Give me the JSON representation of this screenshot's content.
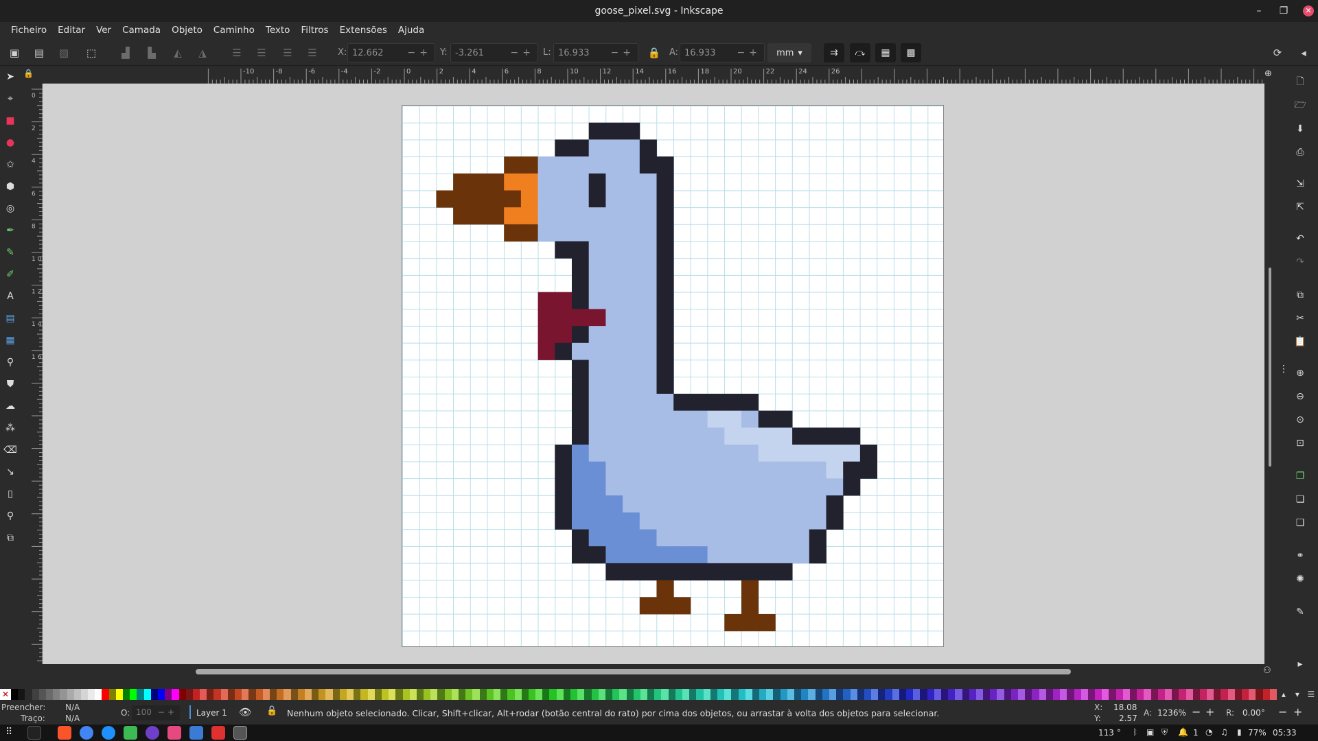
{
  "window": {
    "title": "goose_pixel.svg - Inkscape"
  },
  "menu": [
    "Ficheiro",
    "Editar",
    "Ver",
    "Camada",
    "Objeto",
    "Caminho",
    "Texto",
    "Filtros",
    "Extensões",
    "Ajuda"
  ],
  "toolbar": {
    "x_label": "X:",
    "x_value": "12.662",
    "y_label": "Y:",
    "y_value": "-3.261",
    "w_label": "L:",
    "w_value": "16.933",
    "h_label": "A:",
    "h_value": "16.933",
    "unit": "mm"
  },
  "ruler_top_labels": [
    "-10",
    "-8",
    "-6",
    "-4",
    "-2",
    "0",
    "2",
    "4",
    "6",
    "8",
    "10",
    "12",
    "14",
    "16",
    "18",
    "20",
    "22",
    "24",
    "26"
  ],
  "ruler_left_labels": [
    "0",
    "2",
    "4",
    "6",
    "8",
    "1 0",
    "1 2",
    "1 4",
    "1 6"
  ],
  "status": {
    "fill_label": "Preencher:",
    "fill_value": "N/A",
    "stroke_label": "Traço:",
    "stroke_value": "N/A",
    "opacity_label": "O:",
    "opacity_value": "100",
    "layer": "Layer 1",
    "message": "Nenhum objeto selecionado. Clicar, Shift+clicar, Alt+rodar (botão central do rato) por cima dos objetos, ou arrastar à volta dos objetos para selecionar.",
    "cursor_x_label": "X:",
    "cursor_x": "18.08",
    "cursor_y_label": "Y:",
    "cursor_y": "2.57",
    "zoom_label": "A:",
    "zoom": "1236%",
    "rotation_label": "R:",
    "rotation": "0.00°"
  },
  "tray": {
    "temperature": "113 °",
    "workspace": "1",
    "battery": "77%",
    "clock": "05:33"
  },
  "colors": {
    "outline": "#22222e",
    "body_light": "#a7bde6",
    "body_pale": "#c4d3ee",
    "body_dark": "#6b8fd4",
    "beak": "#f07f1f",
    "beak_dark": "#6b3309",
    "scarf": "#7a1530",
    "legs": "#6b3309"
  },
  "pixel_art": {
    "legend": {
      "K": "outline",
      "B": "body_light",
      "P": "body_pale",
      "D": "body_dark",
      "O": "beak",
      "R": "beak_dark",
      "S": "scarf",
      "L": "legs"
    },
    "rows": [
      "..........................",
      "...........KKK............",
      ".........KKBBBK...........",
      "......RRBBBBBBKK..........",
      "...RRROOBBBKBBBK..........",
      "..RRRRROBBBKBBBK..........",
      "...RRROOBBBBBBBK..........",
      "......RRBBBBBBBK..........",
      ".........KKBBBBK..........",
      "..........KBBBBK..........",
      "..........KBBBBK..........",
      "........SSKBBBBK..........",
      "........SSSSBBBK..........",
      "........SSKBBBBK..........",
      "........SKBBBBBK..........",
      "..........KBBBBK..........",
      "..........KBBBBK..........",
      "..........KBBBBBKKKKK.....",
      "..........KBBBBBBBPPBKK...",
      "..........KBBBBBBBBPPPPKKKK",
      ".........KDBBBBBBBBBBPPPPPPK",
      ".........KDDBBBBBBBBBBBBBPKK",
      ".........KDDBBBBBBBBBBBBBBK.",
      ".........KDDDBBBBBBBBBBBBK..",
      ".........KDDDDBBBBBBBBBBBK..",
      "..........KDDDDBBBBBBBBBK...",
      "..........KKDDDDDDBBBBBBK...",
      "............KKKKKKKKKKK.....",
      "...............L....L.......",
      "..............LLL...L.......",
      "...................LLL......",
      ".........................."
    ]
  }
}
